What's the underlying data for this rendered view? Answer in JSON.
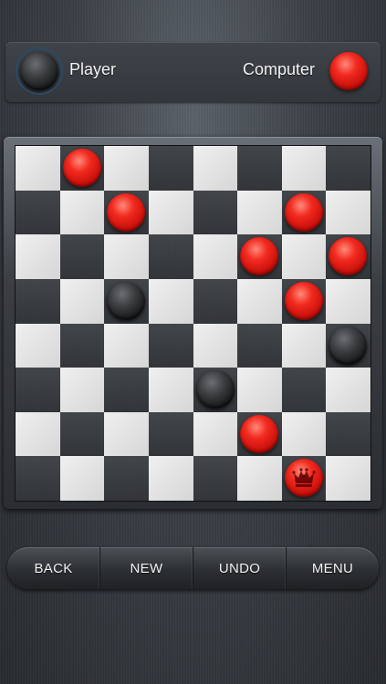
{
  "hud": {
    "player_label": "Player",
    "computer_label": "Computer",
    "player_piece_icon": "black-checker-icon",
    "computer_piece_icon": "red-checker-icon"
  },
  "colors": {
    "player_piece": "#1a1a1a",
    "computer_piece": "#e01a12",
    "light_square": "#e4e4e4",
    "dark_square": "#34373b"
  },
  "board": {
    "size": 8,
    "pieces": [
      {
        "row": 0,
        "col": 1,
        "color": "red",
        "king": false
      },
      {
        "row": 1,
        "col": 2,
        "color": "red",
        "king": false
      },
      {
        "row": 1,
        "col": 6,
        "color": "red",
        "king": false
      },
      {
        "row": 2,
        "col": 5,
        "color": "red",
        "king": false
      },
      {
        "row": 2,
        "col": 7,
        "color": "red",
        "king": false
      },
      {
        "row": 3,
        "col": 2,
        "color": "black",
        "king": false
      },
      {
        "row": 3,
        "col": 6,
        "color": "red",
        "king": false
      },
      {
        "row": 4,
        "col": 7,
        "color": "black",
        "king": false
      },
      {
        "row": 5,
        "col": 4,
        "color": "black",
        "king": false
      },
      {
        "row": 6,
        "col": 5,
        "color": "red",
        "king": false
      },
      {
        "row": 7,
        "col": 6,
        "color": "red",
        "king": true
      }
    ]
  },
  "toolbar": {
    "back_label": "BACK",
    "new_label": "NEW",
    "undo_label": "UNDO",
    "menu_label": "MENU"
  }
}
